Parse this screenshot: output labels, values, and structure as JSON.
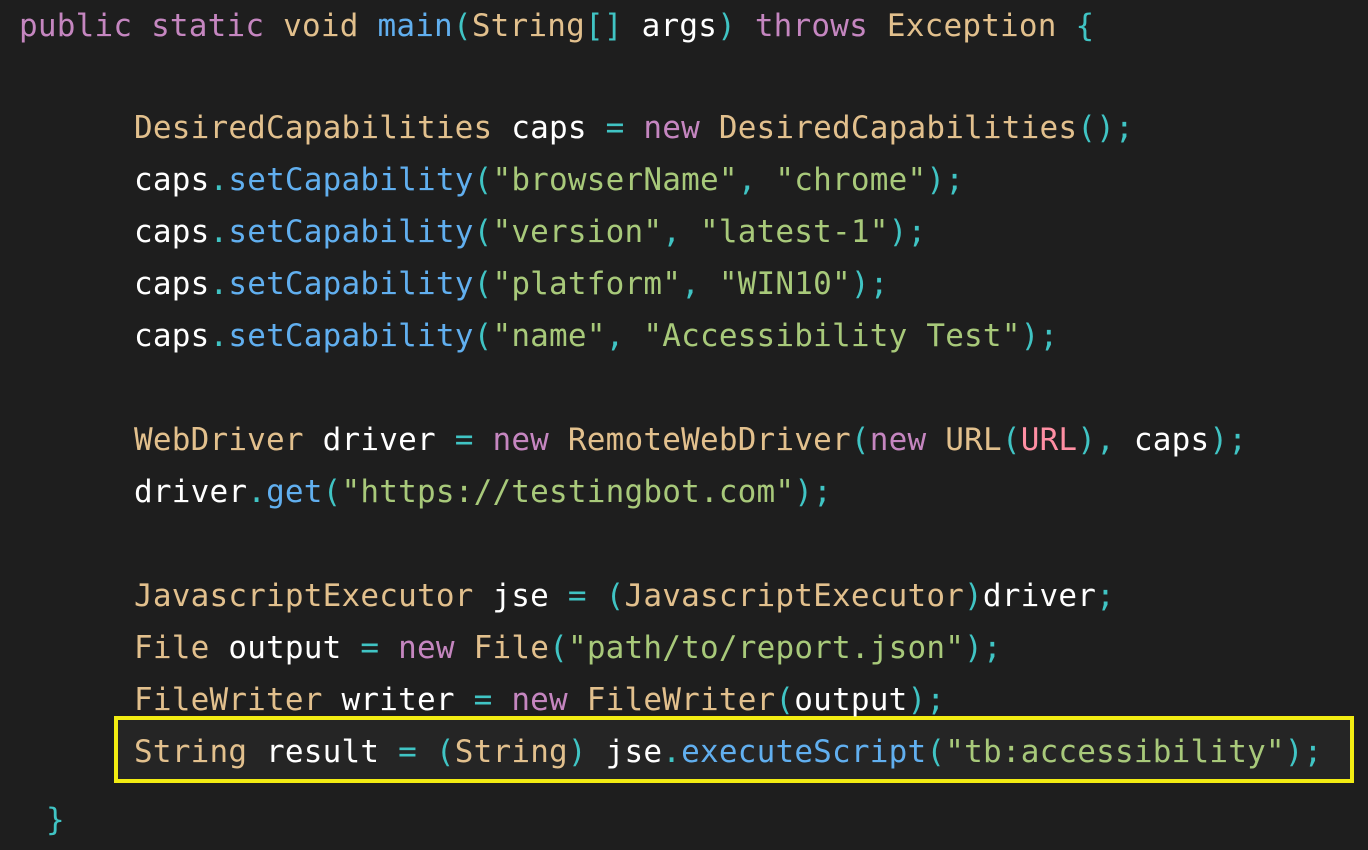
{
  "code_lines": [
    {
      "id": "line-main-signature",
      "tokens": [
        {
          "t": "public",
          "c": "kw"
        },
        {
          "t": " ",
          "c": "var"
        },
        {
          "t": "static",
          "c": "kw"
        },
        {
          "t": " ",
          "c": "var"
        },
        {
          "t": "void",
          "c": "type"
        },
        {
          "t": " ",
          "c": "var"
        },
        {
          "t": "main",
          "c": "fn"
        },
        {
          "t": "(",
          "c": "punc"
        },
        {
          "t": "String",
          "c": "type"
        },
        {
          "t": "[]",
          "c": "punc"
        },
        {
          "t": " args",
          "c": "var"
        },
        {
          "t": ")",
          "c": "punc"
        },
        {
          "t": " ",
          "c": "var"
        },
        {
          "t": "throws",
          "c": "kw"
        },
        {
          "t": " ",
          "c": "var"
        },
        {
          "t": "Exception",
          "c": "type"
        },
        {
          "t": " ",
          "c": "var"
        },
        {
          "t": "{",
          "c": "punc"
        }
      ]
    },
    {
      "id": "line-caps-declare",
      "tokens": [
        {
          "t": "DesiredCapabilities",
          "c": "type"
        },
        {
          "t": " caps ",
          "c": "var"
        },
        {
          "t": "=",
          "c": "punc"
        },
        {
          "t": " ",
          "c": "var"
        },
        {
          "t": "new",
          "c": "kw"
        },
        {
          "t": " ",
          "c": "var"
        },
        {
          "t": "DesiredCapabilities",
          "c": "type"
        },
        {
          "t": "();",
          "c": "punc"
        }
      ]
    },
    {
      "id": "line-caps-browser",
      "tokens": [
        {
          "t": "caps",
          "c": "var"
        },
        {
          "t": ".",
          "c": "punc"
        },
        {
          "t": "setCapability",
          "c": "fn"
        },
        {
          "t": "(",
          "c": "punc"
        },
        {
          "t": "\"browserName\"",
          "c": "str"
        },
        {
          "t": ", ",
          "c": "punc"
        },
        {
          "t": "\"chrome\"",
          "c": "str"
        },
        {
          "t": ");",
          "c": "punc"
        }
      ]
    },
    {
      "id": "line-caps-version",
      "tokens": [
        {
          "t": "caps",
          "c": "var"
        },
        {
          "t": ".",
          "c": "punc"
        },
        {
          "t": "setCapability",
          "c": "fn"
        },
        {
          "t": "(",
          "c": "punc"
        },
        {
          "t": "\"version\"",
          "c": "str"
        },
        {
          "t": ", ",
          "c": "punc"
        },
        {
          "t": "\"latest-1\"",
          "c": "str"
        },
        {
          "t": ");",
          "c": "punc"
        }
      ]
    },
    {
      "id": "line-caps-platform",
      "tokens": [
        {
          "t": "caps",
          "c": "var"
        },
        {
          "t": ".",
          "c": "punc"
        },
        {
          "t": "setCapability",
          "c": "fn"
        },
        {
          "t": "(",
          "c": "punc"
        },
        {
          "t": "\"platform\"",
          "c": "str"
        },
        {
          "t": ", ",
          "c": "punc"
        },
        {
          "t": "\"WIN10\"",
          "c": "str"
        },
        {
          "t": ");",
          "c": "punc"
        }
      ]
    },
    {
      "id": "line-caps-name",
      "tokens": [
        {
          "t": "caps",
          "c": "var"
        },
        {
          "t": ".",
          "c": "punc"
        },
        {
          "t": "setCapability",
          "c": "fn"
        },
        {
          "t": "(",
          "c": "punc"
        },
        {
          "t": "\"name\"",
          "c": "str"
        },
        {
          "t": ", ",
          "c": "punc"
        },
        {
          "t": "\"Accessibility Test\"",
          "c": "str"
        },
        {
          "t": ");",
          "c": "punc"
        }
      ]
    },
    {
      "id": "line-driver-declare",
      "tokens": [
        {
          "t": "WebDriver",
          "c": "type"
        },
        {
          "t": " driver ",
          "c": "var"
        },
        {
          "t": "=",
          "c": "punc"
        },
        {
          "t": " ",
          "c": "var"
        },
        {
          "t": "new",
          "c": "kw"
        },
        {
          "t": " ",
          "c": "var"
        },
        {
          "t": "RemoteWebDriver",
          "c": "type"
        },
        {
          "t": "(",
          "c": "punc"
        },
        {
          "t": "new",
          "c": "kw"
        },
        {
          "t": " ",
          "c": "var"
        },
        {
          "t": "URL",
          "c": "type"
        },
        {
          "t": "(",
          "c": "punc"
        },
        {
          "t": "URL",
          "c": "pink"
        },
        {
          "t": "), ",
          "c": "punc"
        },
        {
          "t": "caps",
          "c": "var"
        },
        {
          "t": ");",
          "c": "punc"
        }
      ]
    },
    {
      "id": "line-driver-get",
      "tokens": [
        {
          "t": "driver",
          "c": "var"
        },
        {
          "t": ".",
          "c": "punc"
        },
        {
          "t": "get",
          "c": "fn"
        },
        {
          "t": "(",
          "c": "punc"
        },
        {
          "t": "\"https://testingbot.com\"",
          "c": "str"
        },
        {
          "t": ");",
          "c": "punc"
        }
      ]
    },
    {
      "id": "line-jse-declare",
      "tokens": [
        {
          "t": "JavascriptExecutor",
          "c": "type"
        },
        {
          "t": " jse ",
          "c": "var"
        },
        {
          "t": "=",
          "c": "punc"
        },
        {
          "t": " ",
          "c": "var"
        },
        {
          "t": "(",
          "c": "punc"
        },
        {
          "t": "JavascriptExecutor",
          "c": "type"
        },
        {
          "t": ")",
          "c": "punc"
        },
        {
          "t": "driver",
          "c": "var"
        },
        {
          "t": ";",
          "c": "punc"
        }
      ]
    },
    {
      "id": "line-file-declare",
      "tokens": [
        {
          "t": "File",
          "c": "type"
        },
        {
          "t": " output ",
          "c": "var"
        },
        {
          "t": "=",
          "c": "punc"
        },
        {
          "t": " ",
          "c": "var"
        },
        {
          "t": "new",
          "c": "kw"
        },
        {
          "t": " ",
          "c": "var"
        },
        {
          "t": "File",
          "c": "type"
        },
        {
          "t": "(",
          "c": "punc"
        },
        {
          "t": "\"path/to/report.json\"",
          "c": "str"
        },
        {
          "t": ");",
          "c": "punc"
        }
      ]
    },
    {
      "id": "line-writer-declare",
      "tokens": [
        {
          "t": "FileWriter",
          "c": "type"
        },
        {
          "t": " writer ",
          "c": "var"
        },
        {
          "t": "=",
          "c": "punc"
        },
        {
          "t": " ",
          "c": "var"
        },
        {
          "t": "new",
          "c": "kw"
        },
        {
          "t": " ",
          "c": "var"
        },
        {
          "t": "FileWriter",
          "c": "type"
        },
        {
          "t": "(",
          "c": "punc"
        },
        {
          "t": "output",
          "c": "var"
        },
        {
          "t": ");",
          "c": "punc"
        }
      ]
    },
    {
      "id": "line-result-execute",
      "tokens": [
        {
          "t": "String",
          "c": "type"
        },
        {
          "t": " result ",
          "c": "var"
        },
        {
          "t": "=",
          "c": "punc"
        },
        {
          "t": " ",
          "c": "var"
        },
        {
          "t": "(",
          "c": "punc"
        },
        {
          "t": "String",
          "c": "type"
        },
        {
          "t": ")",
          "c": "punc"
        },
        {
          "t": " jse",
          "c": "var"
        },
        {
          "t": ".",
          "c": "punc"
        },
        {
          "t": "executeScript",
          "c": "fn"
        },
        {
          "t": "(",
          "c": "punc"
        },
        {
          "t": "\"tb:accessibility\"",
          "c": "str"
        },
        {
          "t": ");",
          "c": "punc"
        }
      ]
    },
    {
      "id": "line-close-brace",
      "tokens": [
        {
          "t": "}",
          "c": "punc"
        }
      ]
    }
  ],
  "highlight": {
    "line_id": "line-result-execute",
    "border_color": "#f2ec12"
  },
  "colors": {
    "background": "#1e1e1e",
    "keyword": "#c586c0",
    "type": "#e2c08d",
    "function": "#61afef",
    "string": "#a8c97a",
    "punctuation": "#40c4c4",
    "identifier": "#ffffff",
    "url_constant": "#ff8fa3"
  }
}
